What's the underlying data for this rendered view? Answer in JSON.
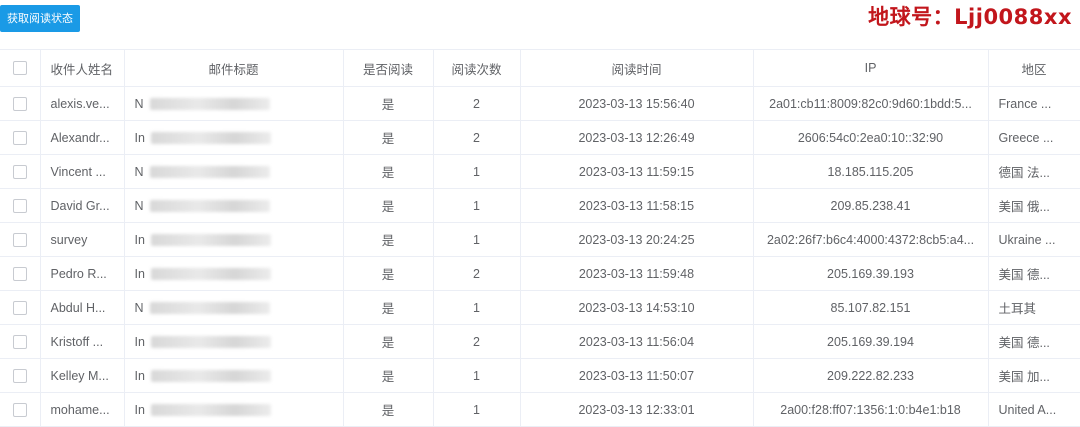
{
  "toolbar": {
    "fetch_status_label": "获取阅读状态"
  },
  "watermark": "地球号：Ljj0088xx",
  "table": {
    "headers": {
      "name": "收件人姓名",
      "subject": "邮件标题",
      "is_read": "是否阅读",
      "read_count": "阅读次数",
      "read_time": "阅读时间",
      "ip": "IP",
      "region": "地区"
    },
    "rows": [
      {
        "name": "alexis.ve...",
        "subject": "N",
        "read": "是",
        "count": "2",
        "time": "2023-03-13 15:56:40",
        "ip": "2a01:cb11:8009:82c0:9d60:1bdd:5...",
        "region": "France ..."
      },
      {
        "name": "Alexandr...",
        "subject": "In",
        "read": "是",
        "count": "2",
        "time": "2023-03-13 12:26:49",
        "ip": "2606:54c0:2ea0:10::32:90",
        "region": "Greece ..."
      },
      {
        "name": "Vincent ...",
        "subject": "N",
        "read": "是",
        "count": "1",
        "time": "2023-03-13 11:59:15",
        "ip": "18.185.115.205",
        "region": "德国 法..."
      },
      {
        "name": "David Gr...",
        "subject": "N",
        "read": "是",
        "count": "1",
        "time": "2023-03-13 11:58:15",
        "ip": "209.85.238.41",
        "region": "美国 俄..."
      },
      {
        "name": "survey",
        "subject": "In",
        "read": "是",
        "count": "1",
        "time": "2023-03-13 20:24:25",
        "ip": "2a02:26f7:b6c4:4000:4372:8cb5:a4...",
        "region": "Ukraine ..."
      },
      {
        "name": "Pedro R...",
        "subject": "In",
        "read": "是",
        "count": "2",
        "time": "2023-03-13 11:59:48",
        "ip": "205.169.39.193",
        "region": "美国 德..."
      },
      {
        "name": "Abdul H...",
        "subject": "N",
        "read": "是",
        "count": "1",
        "time": "2023-03-13 14:53:10",
        "ip": "85.107.82.151",
        "region": "土耳其"
      },
      {
        "name": "Kristoff ...",
        "subject": "In",
        "read": "是",
        "count": "2",
        "time": "2023-03-13 11:56:04",
        "ip": "205.169.39.194",
        "region": "美国 德..."
      },
      {
        "name": "Kelley M...",
        "subject": "In",
        "read": "是",
        "count": "1",
        "time": "2023-03-13 11:50:07",
        "ip": "209.222.82.233",
        "region": "美国 加..."
      },
      {
        "name": "mohame...",
        "subject": "In",
        "read": "是",
        "count": "1",
        "time": "2023-03-13 12:33:01",
        "ip": "2a00:f28:ff07:1356:1:0:b4e1:b18",
        "region": "United A..."
      }
    ]
  }
}
